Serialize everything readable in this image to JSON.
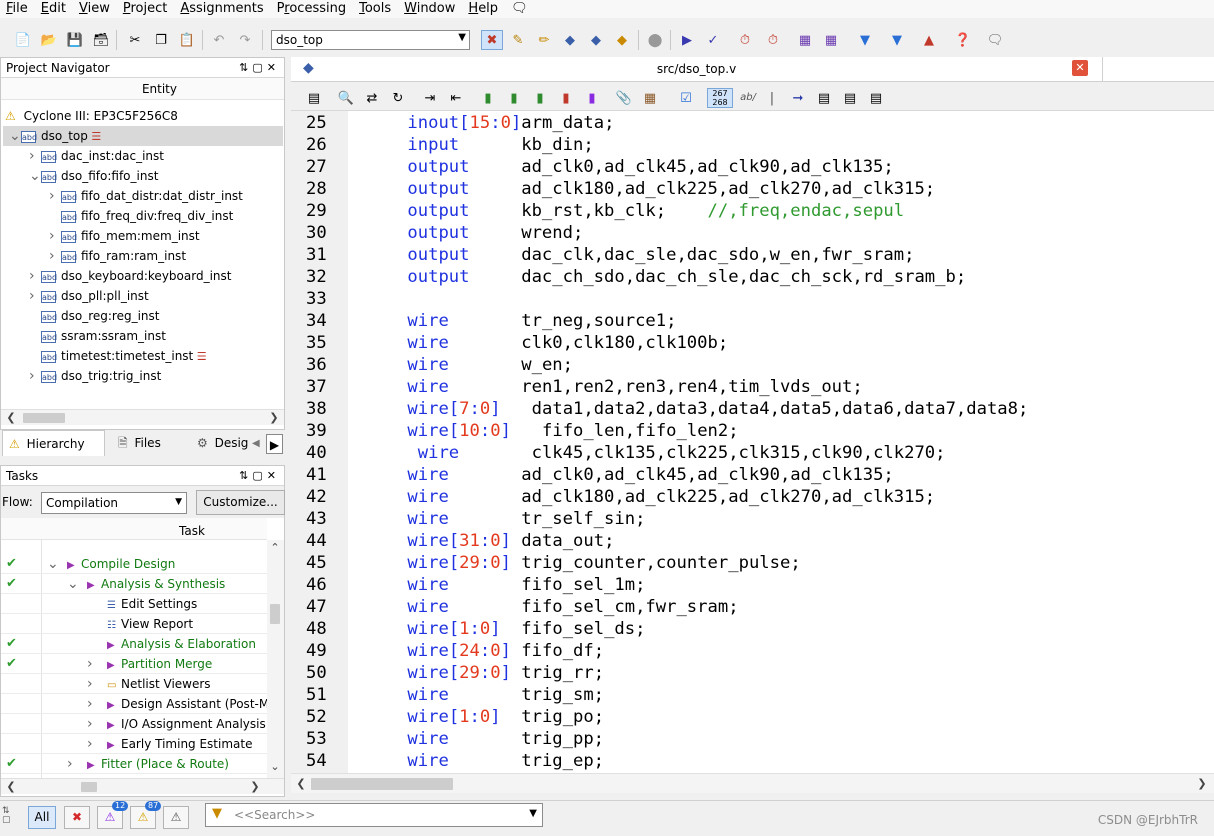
{
  "menu": [
    "File",
    "Edit",
    "View",
    "Project",
    "Assignments",
    "Processing",
    "Tools",
    "Window",
    "Help"
  ],
  "menu_underline": [
    "F",
    "E",
    "V",
    "P",
    "A",
    "r",
    "T",
    "W",
    "H"
  ],
  "toolbar": {
    "entity_value": "dso_top"
  },
  "project_navigator": {
    "title": "Project Navigator",
    "column_header": "Entity",
    "device": "Cyclone III: EP3C5F256C8",
    "tree": [
      {
        "label": "dso_top",
        "level": 0,
        "expander": "v",
        "selected": true
      },
      {
        "label": "dac_inst:dac_inst",
        "level": 1,
        "expander": ">"
      },
      {
        "label": "dso_fifo:fifo_inst",
        "level": 1,
        "expander": "v"
      },
      {
        "label": "fifo_dat_distr:dat_distr_inst",
        "level": 2,
        "expander": ">"
      },
      {
        "label": "fifo_freq_div:freq_div_inst",
        "level": 2,
        "expander": ""
      },
      {
        "label": "fifo_mem:mem_inst",
        "level": 2,
        "expander": ">"
      },
      {
        "label": "fifo_ram:ram_inst",
        "level": 2,
        "expander": ">"
      },
      {
        "label": "dso_keyboard:keyboard_inst",
        "level": 1,
        "expander": ">"
      },
      {
        "label": "dso_pll:pll_inst",
        "level": 1,
        "expander": ">"
      },
      {
        "label": "dso_reg:reg_inst",
        "level": 1,
        "expander": ""
      },
      {
        "label": "ssram:ssram_inst",
        "level": 1,
        "expander": ""
      },
      {
        "label": "timetest:timetest_inst",
        "level": 1,
        "expander": ""
      },
      {
        "label": "dso_trig:trig_inst",
        "level": 1,
        "expander": ">"
      }
    ],
    "tabs": [
      "Hierarchy",
      "Files",
      "Desig"
    ]
  },
  "tasks": {
    "title": "Tasks",
    "flow_label": "Flow:",
    "flow_value": "Compilation",
    "customize_label": "Customize...",
    "column_header": "Task",
    "rows": [
      {
        "label": "Compile Design",
        "level": 0,
        "check": true,
        "expander": "v",
        "icon": "play",
        "green": true
      },
      {
        "label": "Analysis & Synthesis",
        "level": 1,
        "check": true,
        "expander": "v",
        "icon": "play",
        "green": true
      },
      {
        "label": "Edit Settings",
        "level": 2,
        "check": false,
        "expander": "",
        "icon": "settings",
        "green": false
      },
      {
        "label": "View Report",
        "level": 2,
        "check": false,
        "expander": "",
        "icon": "report",
        "green": false
      },
      {
        "label": "Analysis & Elaboration",
        "level": 2,
        "check": true,
        "expander": "",
        "icon": "play",
        "green": true
      },
      {
        "label": "Partition Merge",
        "level": 2,
        "check": true,
        "expander": ">",
        "icon": "play",
        "green": true
      },
      {
        "label": "Netlist Viewers",
        "level": 2,
        "check": false,
        "expander": ">",
        "icon": "folder",
        "green": false
      },
      {
        "label": "Design Assistant (Post-M",
        "level": 2,
        "check": false,
        "expander": ">",
        "icon": "play",
        "green": false
      },
      {
        "label": "I/O Assignment Analysis",
        "level": 2,
        "check": false,
        "expander": ">",
        "icon": "play",
        "green": false
      },
      {
        "label": "Early Timing Estimate",
        "level": 2,
        "check": false,
        "expander": ">",
        "icon": "play",
        "green": false
      },
      {
        "label": "Fitter (Place & Route)",
        "level": 1,
        "check": true,
        "expander": ">",
        "icon": "play",
        "green": true
      }
    ]
  },
  "editor": {
    "tab_title": "src/dso_top.v",
    "lines": [
      {
        "n": "25",
        "t": [
          [
            "    ",
            ""
          ],
          [
            "inout",
            "kw"
          ],
          [
            "[",
            "kw"
          ],
          [
            "15",
            "num"
          ],
          [
            ":",
            "kw"
          ],
          [
            "0",
            "num"
          ],
          [
            "]",
            "kw"
          ],
          [
            "arm_data;",
            ""
          ]
        ]
      },
      {
        "n": "26",
        "t": [
          [
            "    ",
            ""
          ],
          [
            "input",
            "kw"
          ],
          [
            "      kb_din;",
            ""
          ]
        ]
      },
      {
        "n": "27",
        "t": [
          [
            "    ",
            ""
          ],
          [
            "output",
            "kw"
          ],
          [
            "     ad_clk0,ad_clk45,ad_clk90,ad_clk135;",
            ""
          ]
        ]
      },
      {
        "n": "28",
        "t": [
          [
            "    ",
            ""
          ],
          [
            "output",
            "kw"
          ],
          [
            "     ad_clk180,ad_clk225,ad_clk270,ad_clk315;",
            ""
          ]
        ]
      },
      {
        "n": "29",
        "t": [
          [
            "    ",
            ""
          ],
          [
            "output",
            "kw"
          ],
          [
            "     kb_rst,kb_clk;    ",
            ""
          ],
          [
            "//,freq,endac,sepul",
            "cm"
          ]
        ]
      },
      {
        "n": "30",
        "t": [
          [
            "    ",
            ""
          ],
          [
            "output",
            "kw"
          ],
          [
            "     wrend;",
            ""
          ]
        ]
      },
      {
        "n": "31",
        "t": [
          [
            "    ",
            ""
          ],
          [
            "output",
            "kw"
          ],
          [
            "     dac_clk,dac_sle,dac_sdo,w_en,fwr_sram;",
            ""
          ]
        ]
      },
      {
        "n": "32",
        "t": [
          [
            "    ",
            ""
          ],
          [
            "output",
            "kw"
          ],
          [
            "     dac_ch_sdo,dac_ch_sle,dac_ch_sck,rd_sram_b;",
            ""
          ]
        ]
      },
      {
        "n": "33",
        "t": []
      },
      {
        "n": "34",
        "t": [
          [
            "    ",
            ""
          ],
          [
            "wire",
            "kw"
          ],
          [
            "       tr_neg,source1;",
            ""
          ]
        ]
      },
      {
        "n": "35",
        "t": [
          [
            "    ",
            ""
          ],
          [
            "wire",
            "kw"
          ],
          [
            "       clk0,clk180,clk100b;",
            ""
          ]
        ]
      },
      {
        "n": "36",
        "t": [
          [
            "    ",
            ""
          ],
          [
            "wire",
            "kw"
          ],
          [
            "       w_en;",
            ""
          ]
        ]
      },
      {
        "n": "37",
        "t": [
          [
            "    ",
            ""
          ],
          [
            "wire",
            "kw"
          ],
          [
            "       ren1,ren2,ren3,ren4,tim_lvds_out;",
            ""
          ]
        ]
      },
      {
        "n": "38",
        "t": [
          [
            "    ",
            ""
          ],
          [
            "wire",
            "kw"
          ],
          [
            "[",
            "kw"
          ],
          [
            "7",
            "num"
          ],
          [
            ":",
            "kw"
          ],
          [
            "0",
            "num"
          ],
          [
            "]",
            "kw"
          ],
          [
            "   data1,data2,data3,data4,data5,data6,data7,data8;",
            ""
          ]
        ]
      },
      {
        "n": "39",
        "t": [
          [
            "    ",
            ""
          ],
          [
            "wire",
            "kw"
          ],
          [
            "[",
            "kw"
          ],
          [
            "10",
            "num"
          ],
          [
            ":",
            "kw"
          ],
          [
            "0",
            "num"
          ],
          [
            "]",
            "kw"
          ],
          [
            "   fifo_len,fifo_len2;",
            ""
          ]
        ]
      },
      {
        "n": "40",
        "t": [
          [
            "     ",
            ""
          ],
          [
            "wire",
            "kw"
          ],
          [
            "       clk45,clk135,clk225,clk315,clk90,clk270;",
            ""
          ]
        ]
      },
      {
        "n": "41",
        "t": [
          [
            "    ",
            ""
          ],
          [
            "wire",
            "kw"
          ],
          [
            "       ad_clk0,ad_clk45,ad_clk90,ad_clk135;",
            ""
          ]
        ]
      },
      {
        "n": "42",
        "t": [
          [
            "    ",
            ""
          ],
          [
            "wire",
            "kw"
          ],
          [
            "       ad_clk180,ad_clk225,ad_clk270,ad_clk315;",
            ""
          ]
        ]
      },
      {
        "n": "43",
        "t": [
          [
            "    ",
            ""
          ],
          [
            "wire",
            "kw"
          ],
          [
            "       tr_self_sin;",
            ""
          ]
        ]
      },
      {
        "n": "44",
        "t": [
          [
            "    ",
            ""
          ],
          [
            "wire",
            "kw"
          ],
          [
            "[",
            "kw"
          ],
          [
            "31",
            "num"
          ],
          [
            ":",
            "kw"
          ],
          [
            "0",
            "num"
          ],
          [
            "]",
            "kw"
          ],
          [
            " data_out;",
            ""
          ]
        ]
      },
      {
        "n": "45",
        "t": [
          [
            "    ",
            ""
          ],
          [
            "wire",
            "kw"
          ],
          [
            "[",
            "kw"
          ],
          [
            "29",
            "num"
          ],
          [
            ":",
            "kw"
          ],
          [
            "0",
            "num"
          ],
          [
            "]",
            "kw"
          ],
          [
            " trig_counter,counter_pulse;",
            ""
          ]
        ]
      },
      {
        "n": "46",
        "t": [
          [
            "    ",
            ""
          ],
          [
            "wire",
            "kw"
          ],
          [
            "       fifo_sel_1m;",
            ""
          ]
        ]
      },
      {
        "n": "47",
        "t": [
          [
            "    ",
            ""
          ],
          [
            "wire",
            "kw"
          ],
          [
            "       fifo_sel_cm,fwr_sram;",
            ""
          ]
        ]
      },
      {
        "n": "48",
        "t": [
          [
            "    ",
            ""
          ],
          [
            "wire",
            "kw"
          ],
          [
            "[",
            "kw"
          ],
          [
            "1",
            "num"
          ],
          [
            ":",
            "kw"
          ],
          [
            "0",
            "num"
          ],
          [
            "]",
            "kw"
          ],
          [
            "  fifo_sel_ds;",
            ""
          ]
        ]
      },
      {
        "n": "49",
        "t": [
          [
            "    ",
            ""
          ],
          [
            "wire",
            "kw"
          ],
          [
            "[",
            "kw"
          ],
          [
            "24",
            "num"
          ],
          [
            ":",
            "kw"
          ],
          [
            "0",
            "num"
          ],
          [
            "]",
            "kw"
          ],
          [
            " fifo_df;",
            ""
          ]
        ]
      },
      {
        "n": "50",
        "t": [
          [
            "    ",
            ""
          ],
          [
            "wire",
            "kw"
          ],
          [
            "[",
            "kw"
          ],
          [
            "29",
            "num"
          ],
          [
            ":",
            "kw"
          ],
          [
            "0",
            "num"
          ],
          [
            "]",
            "kw"
          ],
          [
            " trig_rr;",
            ""
          ]
        ]
      },
      {
        "n": "51",
        "t": [
          [
            "    ",
            ""
          ],
          [
            "wire",
            "kw"
          ],
          [
            "       trig_sm;",
            ""
          ]
        ]
      },
      {
        "n": "52",
        "t": [
          [
            "    ",
            ""
          ],
          [
            "wire",
            "kw"
          ],
          [
            "[",
            "kw"
          ],
          [
            "1",
            "num"
          ],
          [
            ":",
            "kw"
          ],
          [
            "0",
            "num"
          ],
          [
            "]",
            "kw"
          ],
          [
            "  trig_po;",
            ""
          ]
        ]
      },
      {
        "n": "53",
        "t": [
          [
            "    ",
            ""
          ],
          [
            "wire",
            "kw"
          ],
          [
            "       trig_pp;",
            ""
          ]
        ]
      },
      {
        "n": "54",
        "t": [
          [
            "    ",
            ""
          ],
          [
            "wire",
            "kw"
          ],
          [
            "       trig_ep;",
            ""
          ]
        ]
      }
    ]
  },
  "messages": {
    "all_label": "All",
    "error_badge": "12",
    "warning_badge": "87",
    "search_placeholder": "<<Search>>"
  },
  "watermark": "CSDN @EJrbhTrR",
  "colors": {
    "keyword": "#1f32e0",
    "number": "#e33a1f",
    "comment": "#2f9a2f",
    "task_green": "#117a11"
  }
}
